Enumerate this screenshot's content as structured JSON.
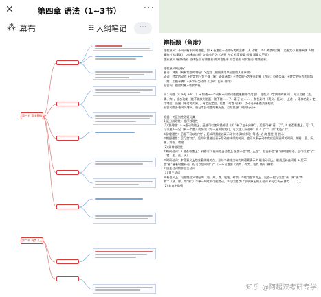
{
  "app": {
    "title": "第四章 语法（1~3节）",
    "close_icon": "close-icon",
    "more_icon": "more-icon",
    "brand": "幕布",
    "outline_label": "大纲笔记",
    "menu_label": "···"
  },
  "mindmap": {
    "root_label": "第一节 语法基础",
    "section2_label": "第二节 词类（上）"
  },
  "document": {
    "heading": "辨析题（角度）",
    "lines": [
      {
        "text": "理性意义：不同词有不同的理据，如 • 着重在于动作行为的主体（人 动物）  ②a 关涉的对象（范围大小  能像具体  人物事物  个体集体）  b对象的特征 ③ 动作行为（结果 方式  程度轻重  轻微  着重点不同）",
        "bold": false
      },
      {
        "text": "色彩意义 (感情色彩  语体色彩  形象色彩  外来语色彩  方言色彩  时代色彩  地域色彩)",
        "bold": false
      },
      {
        "text": "",
        "bold": false
      },
      {
        "text": "理性意义的分析：",
        "bold": false
      },
      {
        "text": "名词：种属（具有包含的特征）>类别（按规律用来区别的人或事物）",
        "bold": false
      },
      {
        "text": "动词：特定的动作 +特定的行为主体（施：语体涵盖）+特定的行为关系对象（办公：办理公事）+特定的行为的倾斜（推、用细平稿）+多个行为动作（打印：打开 操作）",
        "bold": false
      },
      {
        "text": "形容词：使用对象+各状特征",
        "bold": false
      },
      {
        "text": "",
        "bold": false
      },
      {
        "text": "同：词性（v. adj. adv…）→ 知通→一个词有不同的词性要素删除个用法），理性义（字典中的意义），句法功能（主、谓、宾），组合功能（能不能放到前面，能不能……了、着了 过……），和色彩种（褒义、贬义），上述+。语体色彩，使用地位，范围（所对的对象），有定范定位，位置（句首  句末） 话动语多者查资源构式",
        "bold": false
      },
      {
        "text": "形容词等多者词义增义，但已本身看重的概万面。忍耐思想：时间行动→",
        "bold": false
      },
      {
        "text": "",
        "bold": false
      },
      {
        "text": "根据：的区别性理证分类",
        "bold": false
      },
      {
        "text": "1  区分辞理性：程序独理性 →",
        "bold": false
      },
      {
        "text": "(1)  辞理性：a →虚动功能上，还能可以加时量补语（如 “有了三十分钟”），后面可带“着、了”，b 能否看重上，可：1，可以进入一起（有一个重）的情况（如一直到到我们，可以进入补语中：例 a 了”广（如“相当”了”）",
        "bold": false
      },
      {
        "text": "①辞程理性：后面不可以加“完”，后如时量能述表示动作持续的时间：等 备  站  病  靠住  持  担心",
        "bold": false
      },
      {
        "text": "②相经理性：后可加“完”，后如时量能述表示后动作持续的时间，也可以表示动作完成后所延续的时间，如看、丢、折、戴、安慰、收拾",
        "bold": false
      },
      {
        "text": "(2)  异常能理性",
        "bold": false
      },
      {
        "text": "①瞬间动词：a 能否看重上：不能以:1 在有相当动态上 但要不加“完、正在”，后面不加“着”或时量短语，后可以加“了” （错、生、死、灭）",
        "bold": false
      },
      {
        "text": "②时间动词：本身意义上包含着终结的点，总与个终结点有约的语素表示  b 能合动词上：能成后补充词格 + 后不加“着”硬者时量补语，但可以加同时“了”（一不可重要（成为、作为、看似  随时  摸样）",
        "bold": false
      },
      {
        "text": "2  自主动词和非自主动词",
        "bold": false
      },
      {
        "text": "(1)  自主动词",
        "bold": false
      },
      {
        "text": "从有语义上，可控性语义特征的（看、来、跳、吃饭、帮助）①能用在命令上，后面一般可以加“请、来”表“等和””（请、你、用“来”）②单一句话中可能提动，③可以加 为了说明原因的从句词  ④可以表示 并力 …… ），。",
        "bold": false
      },
      {
        "text": "(2)  非自主动词",
        "bold": false
      }
    ]
  },
  "watermark": "知乎 @阿超汉考研专学"
}
